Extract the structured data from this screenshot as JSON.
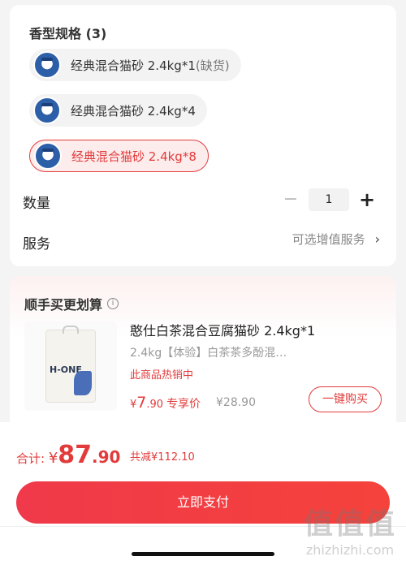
{
  "spec": {
    "title": "香型规格 (3)",
    "options": [
      {
        "label": "经典混合猫砂 2.4kg*1",
        "suffix": "(缺货)"
      },
      {
        "label": "经典混合猫砂 2.4kg*4",
        "suffix": ""
      },
      {
        "label": "经典混合猫砂 2.4kg*8",
        "suffix": ""
      }
    ],
    "quantity_label": "数量",
    "quantity_value": "1",
    "minus": "−",
    "plus": "+",
    "service_label": "服务",
    "service_value": "可选增值服务",
    "service_chevron": "›"
  },
  "bundle": {
    "title": "顺手买更划算",
    "info_glyph": "i",
    "image_brand": "H-ONE",
    "product_name": "憨仕白茶混合豆腐猫砂 2.4kg*1",
    "product_desc": "2.4kg【体验】白茶茶多酚混…",
    "hot_text": "此商品热销中",
    "price_currency": "¥",
    "price_int": "7",
    "price_dec": ".90",
    "price_tag": "专享价",
    "original_price": "¥28.90",
    "buy_label": "一键购买"
  },
  "checkout": {
    "total_label": "合计: ",
    "currency": "¥",
    "amount_int": "87",
    "amount_dec": ".90",
    "saving": "共减¥112.10",
    "pay_label": "立即支付"
  },
  "watermark": {
    "chars": "值值值",
    "site": "zhizhizhi.com"
  },
  "colors": {
    "accent": "#e23b3b",
    "pay_button": "#f23d45"
  }
}
